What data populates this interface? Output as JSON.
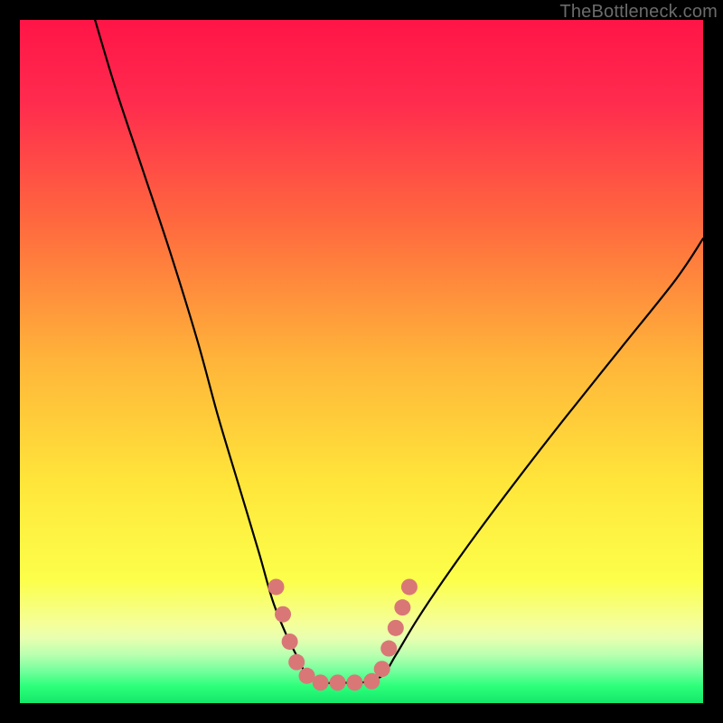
{
  "watermark": "TheBottleneck.com",
  "chart_data": {
    "type": "line",
    "title": "",
    "xlabel": "",
    "ylabel": "",
    "xlim": [
      0,
      100
    ],
    "ylim": [
      0,
      100
    ],
    "grid": false,
    "series": [
      {
        "name": "bottleneck-curve",
        "x": [
          11,
          14,
          18,
          22,
          26,
          29,
          32,
          35,
          37,
          39,
          41,
          42,
          44,
          47,
          50,
          53,
          55,
          58,
          62,
          67,
          73,
          80,
          88,
          96,
          100
        ],
        "y": [
          100,
          90,
          78,
          66,
          53,
          42,
          32,
          22,
          15,
          10,
          6,
          4,
          3,
          3,
          3,
          4,
          7,
          12,
          18,
          25,
          33,
          42,
          52,
          62,
          68
        ]
      }
    ],
    "markers": {
      "name": "highlight-dots",
      "color": "#d97777",
      "points": [
        {
          "x": 37.5,
          "y": 17
        },
        {
          "x": 38.5,
          "y": 13
        },
        {
          "x": 39.5,
          "y": 9
        },
        {
          "x": 40.5,
          "y": 6
        },
        {
          "x": 42.0,
          "y": 4
        },
        {
          "x": 44.0,
          "y": 3
        },
        {
          "x": 46.5,
          "y": 3
        },
        {
          "x": 49.0,
          "y": 3
        },
        {
          "x": 51.5,
          "y": 3.2
        },
        {
          "x": 53.0,
          "y": 5
        },
        {
          "x": 54.0,
          "y": 8
        },
        {
          "x": 55.0,
          "y": 11
        },
        {
          "x": 56.0,
          "y": 14
        },
        {
          "x": 57.0,
          "y": 17
        }
      ]
    },
    "background_gradient": {
      "top": "#ff1a4a",
      "mid1": "#ff7e3a",
      "mid2": "#ffe03a",
      "band": "#f7ff8a",
      "bottom": "#2dff7a"
    }
  }
}
